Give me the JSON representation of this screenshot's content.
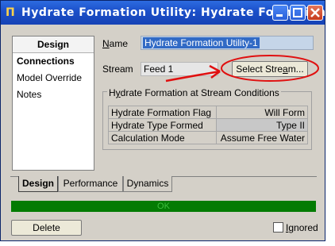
{
  "window": {
    "title": "Hydrate Formation Utility: Hydrate Formation..."
  },
  "side": {
    "header": "Design",
    "items": [
      "Connections",
      "Model Override",
      "Notes"
    ]
  },
  "form": {
    "name_label": "Name",
    "name_value": "Hydrate Formation Utility-1",
    "stream_label": "Stream",
    "stream_value": "Feed 1",
    "select_stream_label": "Select Stream..."
  },
  "group": {
    "title": "Hydrate Formation at Stream Conditions",
    "rows": [
      {
        "label": "Hydrate Formation Flag",
        "value": "Will Form"
      },
      {
        "label": "Hydrate Type Formed",
        "value": "Type II"
      },
      {
        "label": "Calculation Mode",
        "value": "Assume Free Water"
      }
    ]
  },
  "tabs": [
    "Design",
    "Performance",
    "Dynamics"
  ],
  "status": "OK",
  "footer": {
    "delete_label": "Delete",
    "ignored_label": "Ignored"
  },
  "colors": {
    "annotation": "#e01010",
    "status_bg": "#037b03",
    "title_bar": "#1b4fc9"
  }
}
